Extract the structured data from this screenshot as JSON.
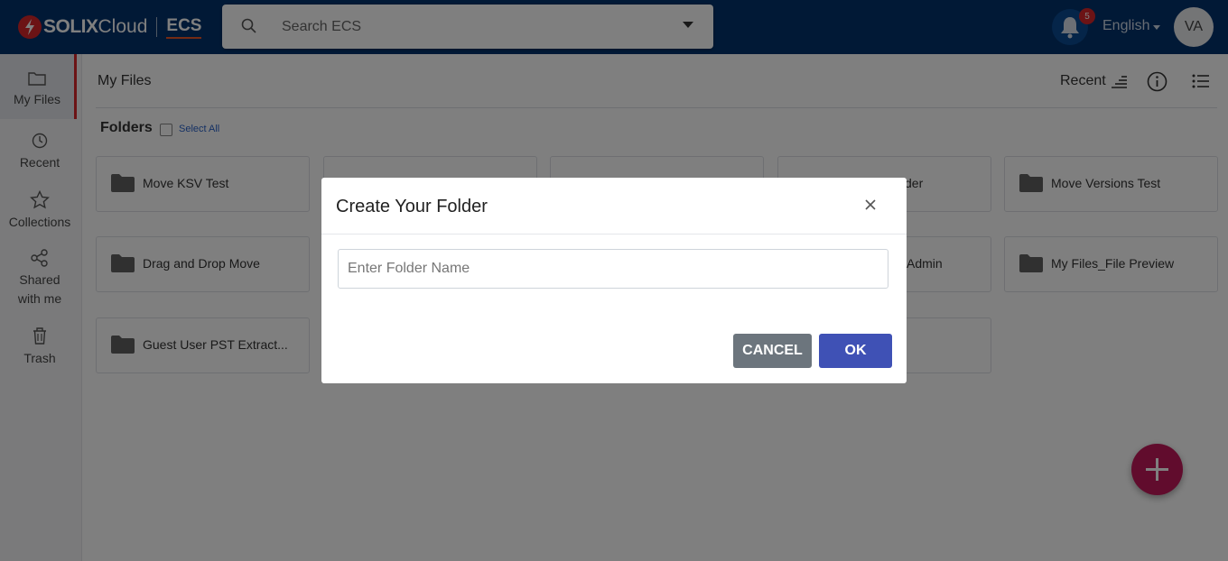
{
  "header": {
    "logo_brand": "SOLIX",
    "logo_cloud": "Cloud",
    "logo_product": "ECS",
    "search_placeholder": "Search ECS",
    "notification_count": "5",
    "language": "English",
    "avatar_initials": "VA"
  },
  "sidebar": {
    "items": [
      {
        "label": "My Files",
        "icon": "folder-icon"
      },
      {
        "label": "Recent",
        "icon": "clock-icon"
      },
      {
        "label": "Collections",
        "icon": "star-icon"
      },
      {
        "label": "Shared with me",
        "icon": "share-icon"
      },
      {
        "label": "Trash",
        "icon": "trash-icon"
      }
    ]
  },
  "main": {
    "title": "My Files",
    "sort_label": "Recent",
    "folders_label": "Folders",
    "select_all": "Select All",
    "folders": [
      "Move KSV Test",
      "der",
      "Move Versions Test",
      "Drag and Drop Move",
      "Admin",
      "My Files_File Preview",
      "Guest User PST Extract..."
    ]
  },
  "modal": {
    "title": "Create Your Folder",
    "input_placeholder": "Enter Folder Name",
    "cancel_label": "CANCEL",
    "ok_label": "OK"
  },
  "colors": {
    "header_bg": "#03336c",
    "accent_red": "#d9262b",
    "ok_button": "#3f51b5",
    "cancel_button": "#6c757d",
    "fab": "#c2185b"
  }
}
